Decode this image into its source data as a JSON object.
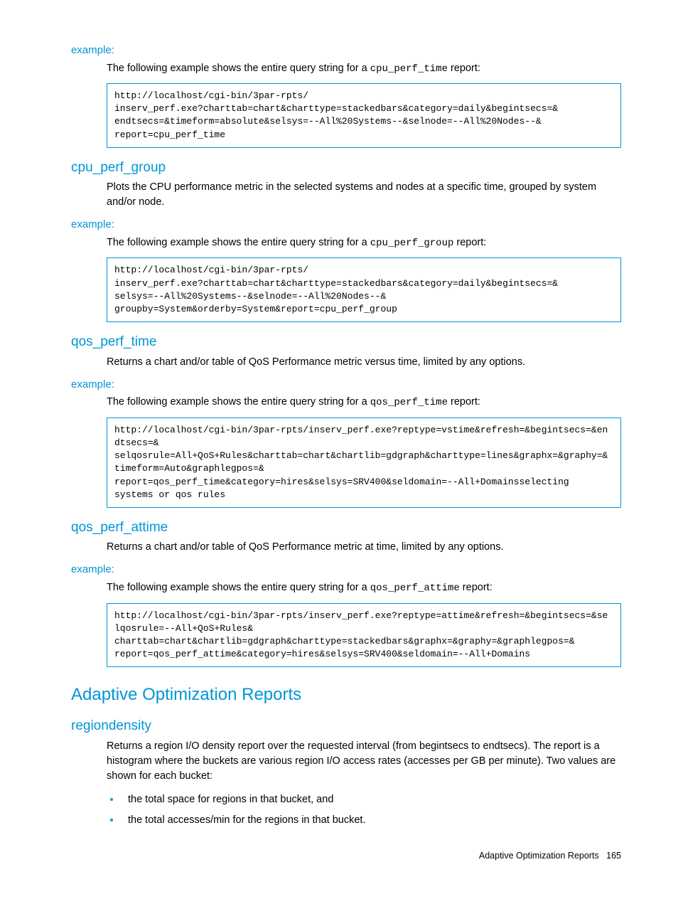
{
  "sec1": {
    "exampleLabel": "example:",
    "introPre": "The following example shows the entire query string for a ",
    "introCode": "cpu_perf_time",
    "introPost": " report:",
    "code": "http://localhost/cgi-bin/3par-rpts/\ninserv_perf.exe?charttab=chart&charttype=stackedbars&category=daily&begintsecs=&\nendtsecs=&timeform=absolute&selsys=--All%20Systems--&selnode=--All%20Nodes--&\nreport=cpu_perf_time"
  },
  "sec2": {
    "heading": "cpu_perf_group",
    "desc": "Plots the CPU performance metric in the selected systems and nodes at a specific time, grouped by system and/or node.",
    "exampleLabel": "example:",
    "introPre": "The following example shows the entire query string for a ",
    "introCode": "cpu_perf_group",
    "introPost": " report:",
    "code": "http://localhost/cgi-bin/3par-rpts/\ninserv_perf.exe?charttab=chart&charttype=stackedbars&category=daily&begintsecs=&\nselsys=--All%20Systems--&selnode=--All%20Nodes--&\ngroupby=System&orderby=System&report=cpu_perf_group"
  },
  "sec3": {
    "heading": "qos_perf_time",
    "desc": "Returns a chart and/or table of QoS Performance metric versus time, limited by any options.",
    "exampleLabel": "example:",
    "introPre": "The following example shows the entire query string for a ",
    "introCode": "qos_perf_time",
    "introPost": " report:",
    "code": "http://localhost/cgi-bin/3par-rpts/inserv_perf.exe?reptype=vstime&refresh=&begintsecs=&endtsecs=&\nselqosrule=All+QoS+Rules&charttab=chart&chartlib=gdgraph&charttype=lines&graphx=&graphy=&timeform=Auto&graphlegpos=&\nreport=qos_perf_time&category=hires&selsys=SRV400&seldomain=--All+Domainsselecting\nsystems or qos rules"
  },
  "sec4": {
    "heading": "qos_perf_attime",
    "desc": "Returns a chart and/or table of QoS Performance metric at time, limited by any options.",
    "exampleLabel": "example:",
    "introPre": "The following example shows the entire query string for a ",
    "introCode": "qos_perf_attime",
    "introPost": " report:",
    "code": "http://localhost/cgi-bin/3par-rpts/inserv_perf.exe?reptype=attime&refresh=&begintsecs=&selqosrule=--All+QoS+Rules&\ncharttab=chart&chartlib=gdgraph&charttype=stackedbars&graphx=&graphy=&graphlegpos=&\nreport=qos_perf_attime&category=hires&selsys=SRV400&seldomain=--All+Domains"
  },
  "sec5": {
    "heading": "Adaptive Optimization Reports",
    "sub": "regiondensity",
    "desc": "Returns a region I/O density report over the requested interval (from begintsecs to endtsecs). The report is a histogram where the buckets are various region I/O access rates (accesses per GB per minute). Two values are shown for each bucket:",
    "bullet1": "the total space for regions in that bucket, and",
    "bullet2": "the total accesses/min for the regions in that bucket."
  },
  "footer": {
    "title": "Adaptive Optimization Reports",
    "page": "165"
  }
}
